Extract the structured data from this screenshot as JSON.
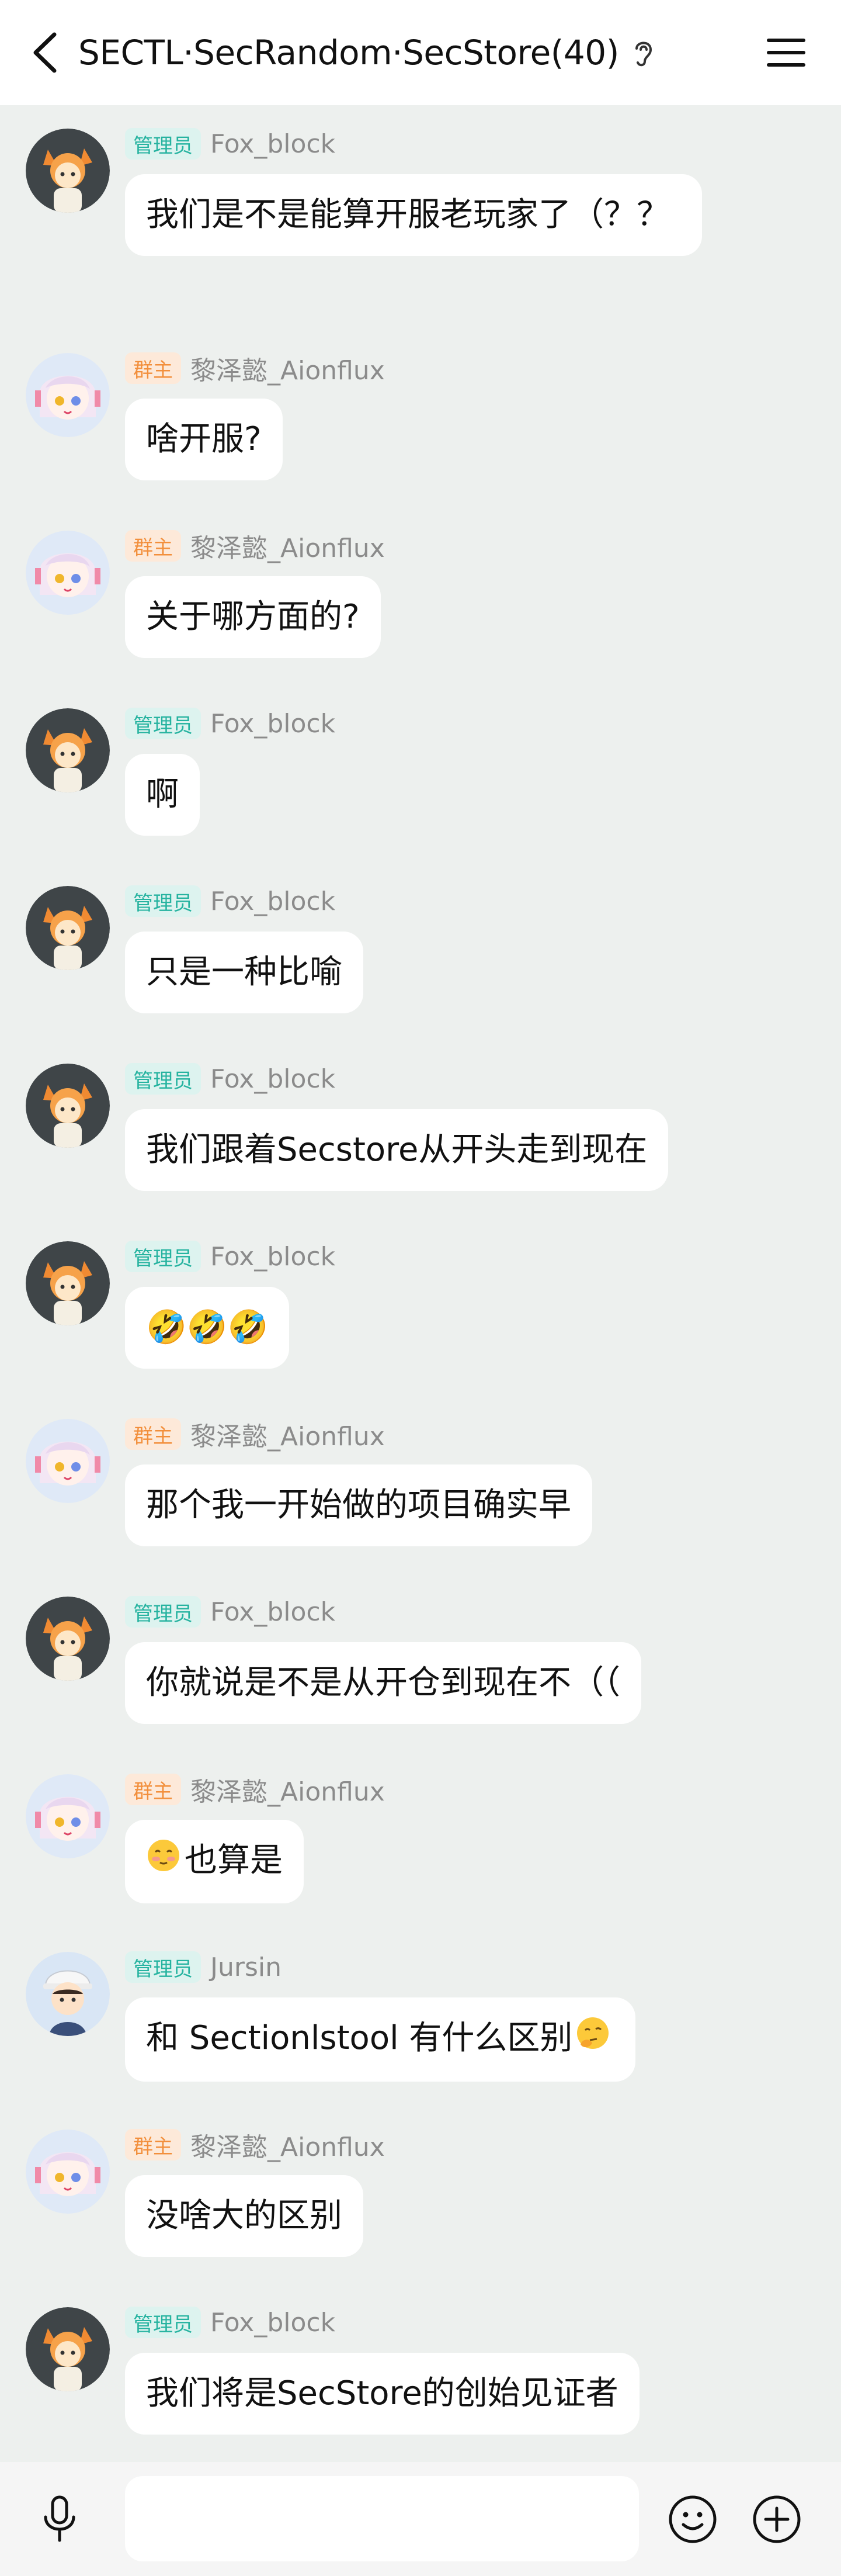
{
  "header": {
    "title": "SECTL·SecRandom·SecStore(40)",
    "back_icon": "chevron-left-icon",
    "ear_icon": "ear-icon",
    "menu_icon": "hamburger-menu-icon"
  },
  "roles": {
    "admin": "管理员",
    "owner": "群主"
  },
  "messages": [
    {
      "role": "管理员",
      "sender": "Fox_block",
      "avatar": "fox-avatar",
      "text": "我们是不是能算开服老玩家了（？？"
    },
    {
      "role": "群主",
      "sender": "黎泽懿_Aionflux",
      "avatar": "anime-girl-avatar",
      "text": "啥开服?"
    },
    {
      "role": "群主",
      "sender": "黎泽懿_Aionflux",
      "avatar": "anime-girl-avatar",
      "text": "关于哪方面的?"
    },
    {
      "role": "管理员",
      "sender": "Fox_block",
      "avatar": "fox-avatar",
      "text": "啊"
    },
    {
      "role": "管理员",
      "sender": "Fox_block",
      "avatar": "fox-avatar",
      "text": "只是一种比喻"
    },
    {
      "role": "管理员",
      "sender": "Fox_block",
      "avatar": "fox-avatar",
      "text": "我们跟着Secstore从开头走到现在"
    },
    {
      "role": "管理员",
      "sender": "Fox_block",
      "avatar": "fox-avatar",
      "text": "🤣🤣🤣"
    },
    {
      "role": "群主",
      "sender": "黎泽懿_Aionflux",
      "avatar": "anime-girl-avatar",
      "text": "那个我一开始做的项目确实早"
    },
    {
      "role": "管理员",
      "sender": "Fox_block",
      "avatar": "fox-avatar",
      "text": "你就说是不是从开仓到现在不（（"
    },
    {
      "role": "群主",
      "sender": "黎泽懿_Aionflux",
      "avatar": "anime-girl-avatar",
      "text": "也算是",
      "emoji": "blushing-face-icon"
    },
    {
      "role": "管理员",
      "sender": "Jursin",
      "avatar": "boy-avatar",
      "text": "和 Sectionlstool 有什么区别",
      "emoji_after": "thinking-face-icon"
    },
    {
      "role": "群主",
      "sender": "黎泽懿_Aionflux",
      "avatar": "anime-girl-avatar",
      "text": "没啥大的区别"
    },
    {
      "role": "管理员",
      "sender": "Fox_block",
      "avatar": "fox-avatar",
      "text": "我们将是SecStore的创始见证者"
    }
  ],
  "composer": {
    "placeholder": "",
    "mic_icon": "microphone-icon",
    "emoji_icon": "smiley-icon",
    "plus_icon": "plus-circle-icon"
  },
  "colors": {
    "background": "#edf0ee",
    "admin_badge_bg": "#ddf3ef",
    "admin_badge_text": "#26b3a0",
    "owner_badge_bg": "#fde9d9",
    "owner_badge_text": "#f28f3c",
    "nick_text": "#8b8b8b"
  }
}
